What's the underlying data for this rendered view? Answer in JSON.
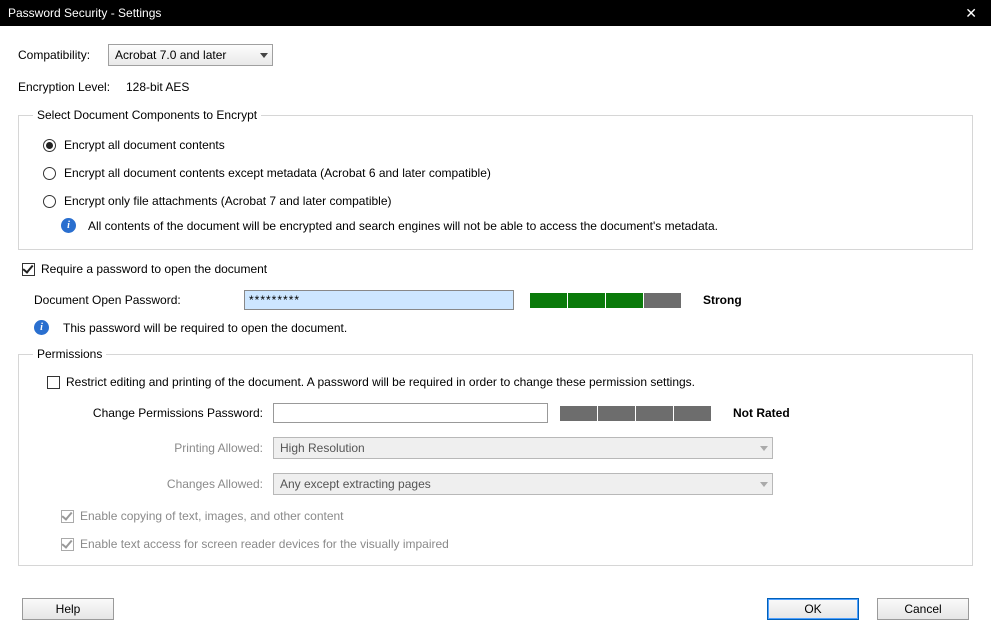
{
  "title": "Password Security - Settings",
  "compatibility": {
    "label": "Compatibility:",
    "value": "Acrobat 7.0 and later"
  },
  "encryption": {
    "label": "Encryption  Level:",
    "value": "128-bit AES"
  },
  "encryptGroup": {
    "legend": "Select Document Components to Encrypt",
    "opt1": "Encrypt all document contents",
    "opt2": "Encrypt all document contents except metadata (Acrobat 6 and later compatible)",
    "opt3": "Encrypt only file attachments (Acrobat 7 and later compatible)",
    "info": "All contents of the document will be encrypted and search engines will not be able to access the document's metadata."
  },
  "requireOpen": {
    "checkLabel": "Require a password to open the document",
    "pwLabel": "Document Open Password:",
    "pwValue": "*********",
    "strengthLabel": "Strong",
    "info": "This password will be required to open the document."
  },
  "permissions": {
    "legend": "Permissions",
    "restrictLabel": "Restrict editing and printing of the document. A password will be required in order to change these permission settings.",
    "changePwLabel": "Change Permissions Password:",
    "strengthLabel": "Not Rated",
    "printingLabel": "Printing Allowed:",
    "printingValue": "High Resolution",
    "changesLabel": "Changes Allowed:",
    "changesValue": "Any except extracting pages",
    "copyLabel": "Enable copying of text, images, and other content",
    "accessLabel": "Enable text access for screen reader devices for the visually impaired"
  },
  "buttons": {
    "help": "Help",
    "ok": "OK",
    "cancel": "Cancel"
  }
}
